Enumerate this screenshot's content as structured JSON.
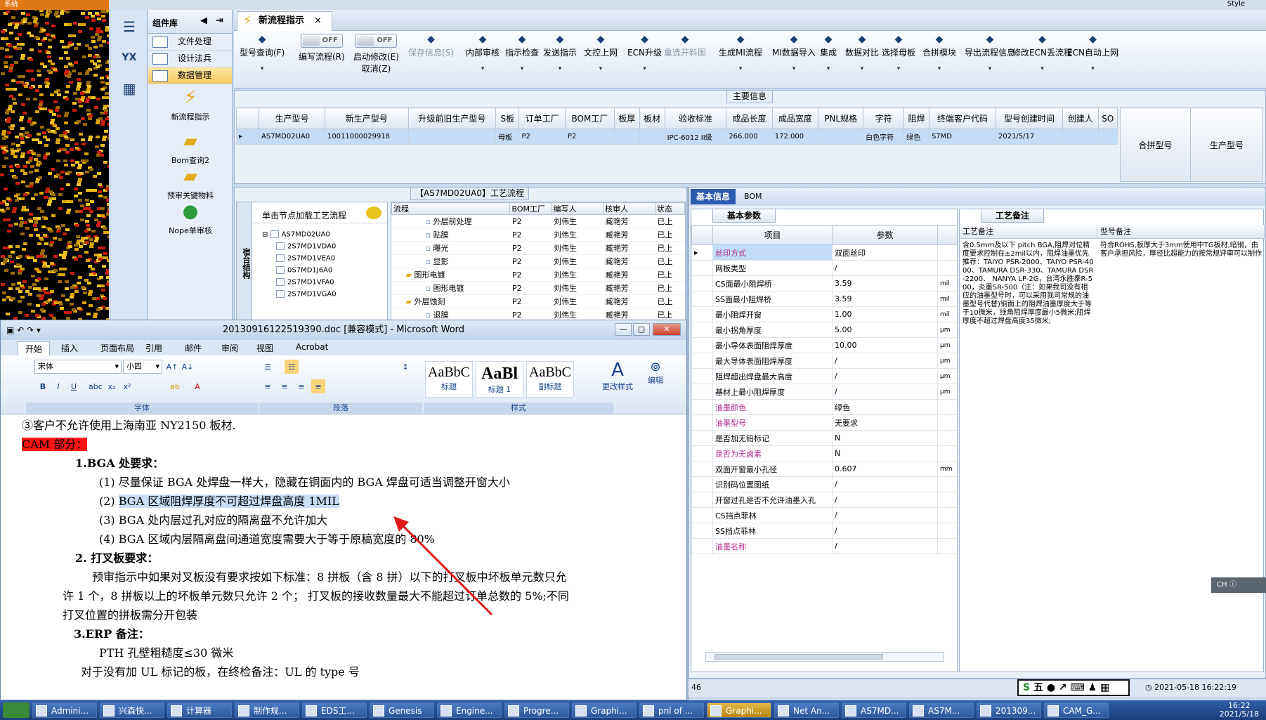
{
  "system_label": "系统",
  "top_right": "Style",
  "component_panel": {
    "title": "组件库",
    "items": [
      {
        "label": "文件处理"
      },
      {
        "label": "设计法兵"
      },
      {
        "label": "数据管理"
      }
    ],
    "tools": [
      {
        "label": "新流程指示"
      },
      {
        "label": "Bom查询2"
      },
      {
        "label": "预审关键物料"
      },
      {
        "label": "Nope单审核"
      }
    ]
  },
  "tab": {
    "label": "新流程指示",
    "close": "×"
  },
  "toolbar": {
    "items": [
      {
        "label": "型号查询(F)",
        "icon": "search-icon"
      },
      {
        "label": "编写流程(R)",
        "toggle": "OFF"
      },
      {
        "label": "启动修改(E)",
        "sub": "取消(Z)",
        "toggle": "OFF"
      },
      {
        "label": "保存信息(S)",
        "icon": "check-icon",
        "disabled": true
      },
      {
        "label": "内部审核",
        "icon": "printer-icon"
      },
      {
        "label": "指示检查",
        "icon": "checkbox-icon"
      },
      {
        "label": "发送指示",
        "icon": "upload-icon"
      },
      {
        "label": "文控上网",
        "icon": "cloud-upload-icon"
      },
      {
        "label": "ECN升级",
        "icon": "network-icon"
      },
      {
        "label": "重选开料图",
        "icon": "image-icon",
        "disabled": true
      },
      {
        "label": "生成MI流程",
        "icon": "nodes-icon"
      },
      {
        "label": "MI数据导入",
        "icon": "import-icon"
      },
      {
        "label": "集成",
        "icon": "download-icon"
      },
      {
        "label": "数据对比",
        "icon": "compare-icon"
      },
      {
        "label": "选择母板",
        "icon": "shuffle-icon"
      },
      {
        "label": "合拼模块",
        "icon": "merge-icon"
      },
      {
        "label": "导出流程信息",
        "icon": "smile-icon"
      },
      {
        "label": "修改ECN丢流程",
        "icon": "wrench-icon"
      },
      {
        "label": "ECN自动上网",
        "icon": "star-icon"
      }
    ]
  },
  "main_info": {
    "title": "主要信息",
    "headers": [
      "生产型号",
      "新生产型号",
      "升级前旧生产型号",
      "S板",
      "订单工厂",
      "BOM工厂",
      "板厚",
      "板材",
      "验收标准",
      "成品长度",
      "成品宽度",
      "PNL规格",
      "字符",
      "阻焊",
      "终端客户代码",
      "型号创建时间",
      "创建人",
      "SO"
    ],
    "row": [
      "AS7MD02UA0",
      "10011000029918",
      "",
      "母板",
      "P2",
      "P2",
      "",
      "",
      "IPC-6012 II级",
      "266.000",
      "172.000",
      "",
      "白色字符",
      "绿色",
      "S7MD",
      "2021/5/17",
      "",
      ""
    ],
    "merge_headers": [
      "合拼型号",
      "生产型号"
    ]
  },
  "flow_panel": {
    "title": "【AS7MD02UA0】工艺流程",
    "tree_side_label": "宿台结构",
    "tree_hint": "单击节点加载工艺流程",
    "tree": [
      "AS7MD02UA0",
      "2S7MD1VDA0",
      "2S7MD1VEA0",
      "0S7MD1J6A0",
      "2S7MD1VFA0",
      "2S7MD1VGA0"
    ],
    "headers": [
      "流程",
      "BOM工厂",
      "编写人",
      "核审人",
      "状态"
    ],
    "rows": [
      {
        "name": "外层前处理",
        "f": "P2",
        "w": "刘伟生",
        "r": "臧艳芳",
        "s": "已上"
      },
      {
        "name": "贴膜",
        "f": "P2",
        "w": "刘伟生",
        "r": "臧艳芳",
        "s": "已上"
      },
      {
        "name": "曝光",
        "f": "P2",
        "w": "刘伟生",
        "r": "臧艳芳",
        "s": "已上"
      },
      {
        "name": "显影",
        "f": "P2",
        "w": "刘伟生",
        "r": "臧艳芳",
        "s": "已上"
      },
      {
        "name": "图形电镀",
        "f": "P2",
        "w": "刘伟生",
        "r": "臧艳芳",
        "s": "已上"
      },
      {
        "name": "图形电镀",
        "f": "P2",
        "w": "刘伟生",
        "r": "臧艳芳",
        "s": "已上"
      },
      {
        "name": "外层蚀刻",
        "f": "P2",
        "w": "刘伟生",
        "r": "臧艳芳",
        "s": "已上"
      },
      {
        "name": "退膜",
        "f": "P2",
        "w": "刘伟生",
        "r": "臧艳芳",
        "s": "已上"
      }
    ]
  },
  "basic_panel": {
    "tab1": "基本信息",
    "tab2": "BOM",
    "params_tab": "基本参数",
    "notes_tab": "工艺备注",
    "param_headers": [
      "项目",
      "参数"
    ],
    "params": [
      {
        "k": "丝印方式",
        "v": "双面丝印",
        "u": "",
        "pink": true
      },
      {
        "k": "网板类型",
        "v": "/",
        "u": ""
      },
      {
        "k": "CS面最小阻焊桥",
        "v": "3.59",
        "u": "mil"
      },
      {
        "k": "SS面最小阻焊桥",
        "v": "3.59",
        "u": "mil"
      },
      {
        "k": "最小阻焊开窗",
        "v": "1.00",
        "u": "mil"
      },
      {
        "k": "最小拐角厚度",
        "v": "5.00",
        "u": "μm"
      },
      {
        "k": "最小导体表面阻焊厚度",
        "v": "10.00",
        "u": "μm"
      },
      {
        "k": "最大导体表面阻焊厚度",
        "v": "/",
        "u": "μm"
      },
      {
        "k": "阻焊超出焊盘最大高度",
        "v": "/",
        "u": "μm"
      },
      {
        "k": "基材上最小阻焊厚度",
        "v": "/",
        "u": "μm"
      },
      {
        "k": "油墨颜色",
        "v": "绿色",
        "u": "",
        "pink": true
      },
      {
        "k": "油墨型号",
        "v": "无要求",
        "u": "",
        "pink": true
      },
      {
        "k": "是否加无铅标记",
        "v": "N",
        "u": ""
      },
      {
        "k": "是否为无卤素",
        "v": "N",
        "u": "",
        "pink": true
      },
      {
        "k": "双面开窗最小孔径",
        "v": "0.607",
        "u": "mm"
      },
      {
        "k": "识别码位置图纸",
        "v": "/",
        "u": ""
      },
      {
        "k": "开窗过孔是否不允许油墨入孔",
        "v": "/",
        "u": ""
      },
      {
        "k": "CS挡点菲林",
        "v": "/",
        "u": ""
      },
      {
        "k": "SS挡点菲林",
        "v": "/",
        "u": ""
      },
      {
        "k": "油墨名称",
        "v": "/",
        "u": "",
        "pink": true
      }
    ],
    "notes_headers": [
      "工艺备注",
      "型号备注"
    ],
    "note_text": "含0.5mm及以下 pitch BGA,阻焊对位精度要求控制在±2mil以内，阻焊油墨优先推荐：TAIYO PSR-2000、TAIYO PSR-4000、TAMURA DSR-330、TAMURA DSR-2200、 NANYA LP-2G，台湾永胜泰R-500，炎墨SR-500（注：如果我司没有相应的油墨型号时，可以采用我司常规的油墨型号代替)铜面上的阻焊油墨厚度大于等于10微米，线角阻焊厚度最小5微米;阻焊厚度不超过焊盘高度35微米;",
    "model_note": "符合ROHS,板厚大于3mm使用中TG板材,暗钢，由客户承担风险，厚径比超能力的按常规评审可以制作"
  },
  "status": {
    "left": "46",
    "ime": "五",
    "clock": "2021-05-18 16:22:19"
  },
  "word": {
    "title": "20130916122519390.doc [兼容模式] - Microsoft Word",
    "tabs": [
      "开始",
      "插入",
      "页面布局",
      "引用",
      "邮件",
      "审阅",
      "视图",
      "Acrobat"
    ],
    "font_name": "宋体",
    "font_size": "小四",
    "groups": [
      "字体",
      "段落",
      "样式"
    ],
    "styles": [
      {
        "sample": "AaBbC",
        "name": "标题"
      },
      {
        "sample": "AaBl",
        "name": "标题 1"
      },
      {
        "sample": "AaBbC",
        "name": "副标题"
      }
    ],
    "change_styles": "更改样式",
    "edit": "编辑",
    "lines": [
      "③客户不允许使用上海南亚 NY2150 板材.",
      "CAM 部分：",
      "1.BGA 处要求：",
      "(1) 尽量保证 BGA 处焊盘一样大，隐藏在铜面内的 BGA 焊盘可适当调整开窗大小",
      "BGA 区域阻焊厚度不可超过焊盘高度 1MIL",
      "(3) BGA 处内层过孔对应的隔离盘不允许加大",
      "(4) BGA 区域内层隔离盘间通道宽度需要大于等于原稿宽度的 80%",
      "2. 打叉板要求：",
      "预审指示中如果对叉板没有要求按如下标准：8 拼板（含 8 拼）以下的打叉板中坏板单元数只允",
      "许 1 个，8 拼板以上的坏板单元数只允许 2 个；  打叉板的接收数量最大不能超过订单总数的 5%;不同",
      "打叉位置的拼板需分开包装",
      "3.ERP 备注：",
      "PTH 孔壁粗糙度≤30 微米",
      "对于没有加 UL 标记的板，在终检备注：UL 的 type 号"
    ],
    "line5_prefix": "(2) "
  },
  "taskbar": {
    "items": [
      "Admini...",
      "兴森快...",
      "计算器",
      "制作规...",
      "EDS工...",
      "Genesis",
      "Engine...",
      "Progre...",
      "Graphi...",
      "pnl of ...",
      "Graphi...",
      "Net An...",
      "AS7MD...",
      "AS7M...",
      "201309...",
      "CAM_G..."
    ],
    "time": "16:22",
    "date": "2021/5/18"
  },
  "ch_float": "CH"
}
